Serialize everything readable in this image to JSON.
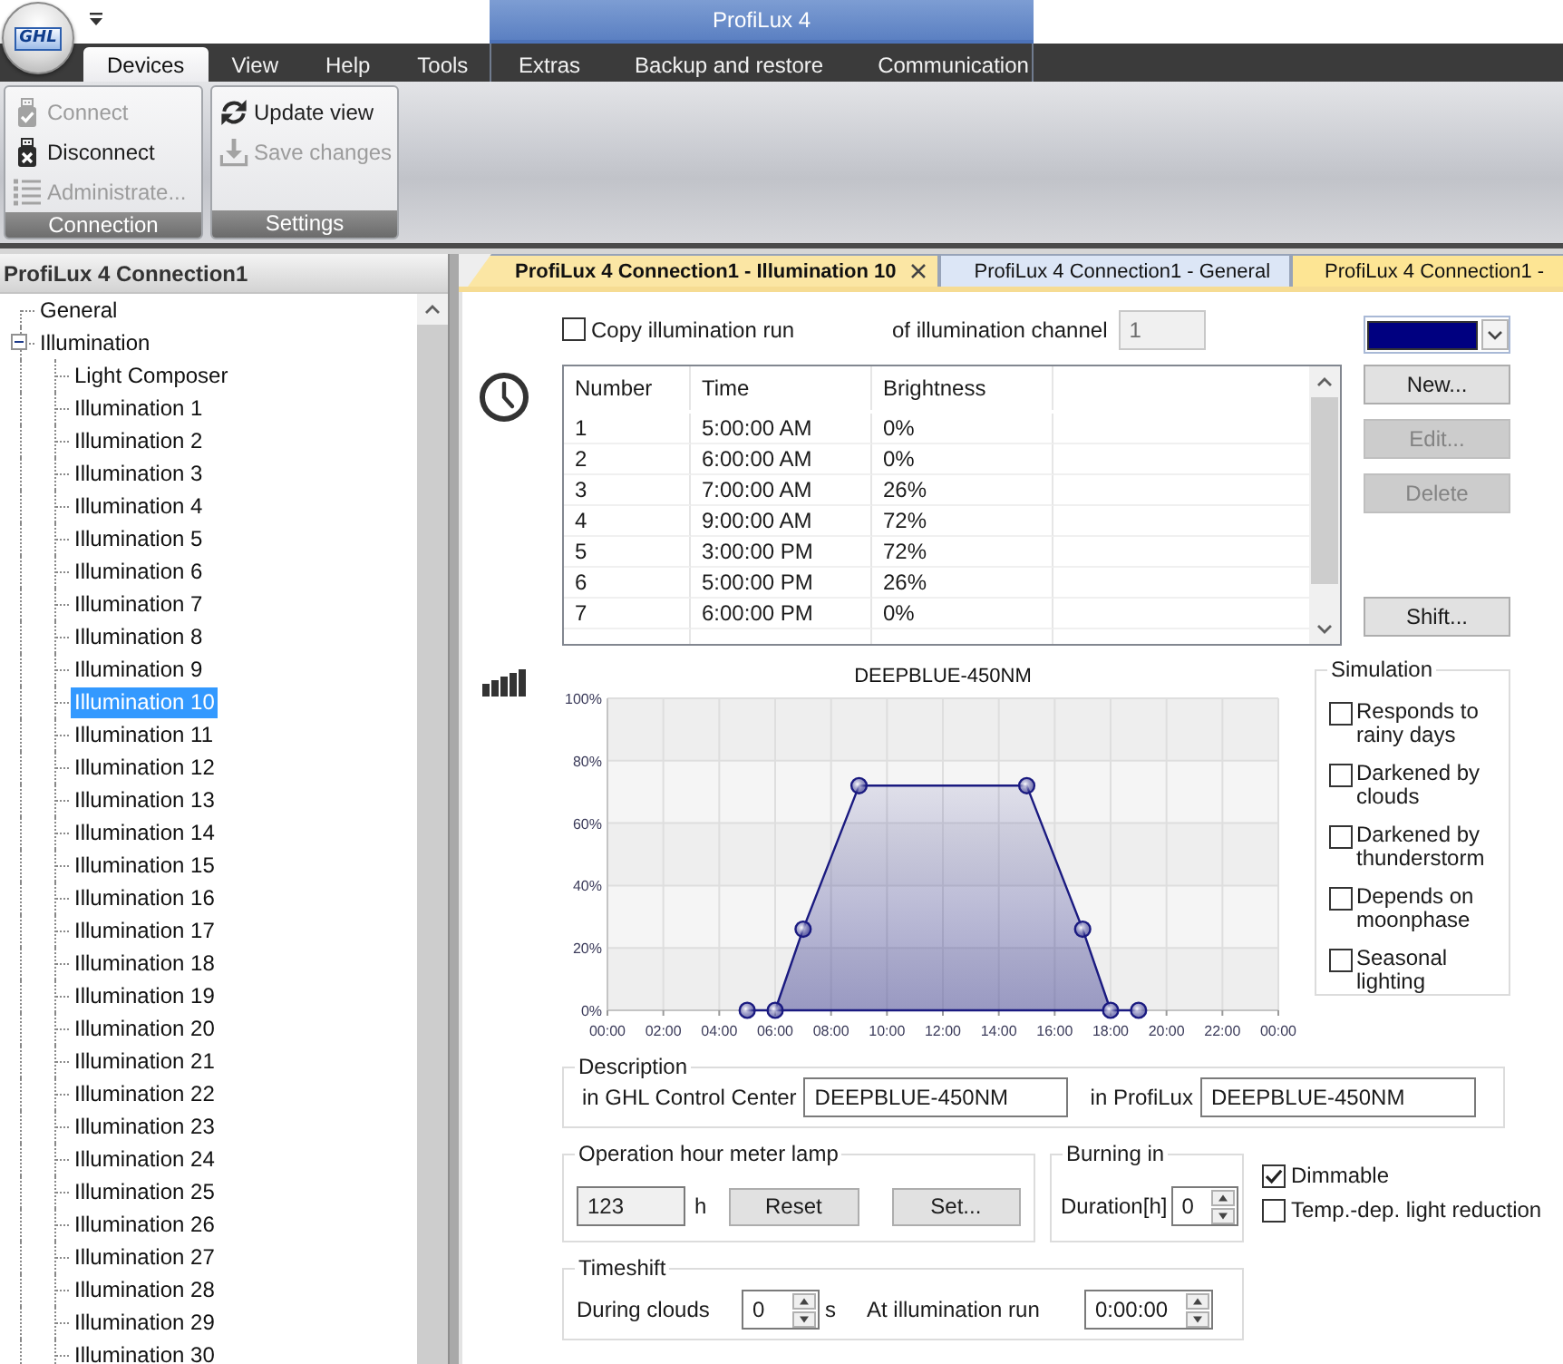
{
  "app": {
    "logo": "GHL"
  },
  "ribbon": {
    "tabs": [
      {
        "label": "Devices",
        "selected": true
      },
      {
        "label": "View",
        "selected": false
      },
      {
        "label": "Help",
        "selected": false
      },
      {
        "label": "Tools",
        "selected": false
      }
    ],
    "contextual_tabs": {
      "title": "ProfiLux 4",
      "tabs": [
        {
          "label": "Extras",
          "selected": false
        },
        {
          "label": "Backup and restore",
          "selected": false
        },
        {
          "label": "Communication",
          "selected": false
        }
      ]
    },
    "groups": [
      {
        "label": "Connection",
        "items": [
          {
            "label": "Connect",
            "disabled": true
          },
          {
            "label": "Disconnect",
            "disabled": false
          },
          {
            "label": "Administrate...",
            "disabled": true
          }
        ]
      },
      {
        "label": "Settings",
        "items": [
          {
            "label": "Update view",
            "disabled": false
          },
          {
            "label": "Save changes",
            "disabled": true
          }
        ]
      }
    ]
  },
  "tree": {
    "title": "ProfiLux 4 Connection1",
    "items": [
      {
        "label": "General",
        "selected": false
      },
      {
        "label": "Illumination",
        "selected": false,
        "expanded": true,
        "children": [
          {
            "label": "Light Composer",
            "selected": false
          },
          {
            "label": "Illumination 1",
            "selected": false
          },
          {
            "label": "Illumination 2",
            "selected": false
          },
          {
            "label": "Illumination 3",
            "selected": false
          },
          {
            "label": "Illumination 4",
            "selected": false
          },
          {
            "label": "Illumination 5",
            "selected": false
          },
          {
            "label": "Illumination 6",
            "selected": false
          },
          {
            "label": "Illumination 7",
            "selected": false
          },
          {
            "label": "Illumination 8",
            "selected": false
          },
          {
            "label": "Illumination 9",
            "selected": false
          },
          {
            "label": "Illumination 10",
            "selected": true
          },
          {
            "label": "Illumination 11",
            "selected": false
          },
          {
            "label": "Illumination 12",
            "selected": false
          },
          {
            "label": "Illumination 13",
            "selected": false
          },
          {
            "label": "Illumination 14",
            "selected": false
          },
          {
            "label": "Illumination 15",
            "selected": false
          },
          {
            "label": "Illumination 16",
            "selected": false
          },
          {
            "label": "Illumination 17",
            "selected": false
          },
          {
            "label": "Illumination 18",
            "selected": false
          },
          {
            "label": "Illumination 19",
            "selected": false
          },
          {
            "label": "Illumination 20",
            "selected": false
          },
          {
            "label": "Illumination 21",
            "selected": false
          },
          {
            "label": "Illumination 22",
            "selected": false
          },
          {
            "label": "Illumination 23",
            "selected": false
          },
          {
            "label": "Illumination 24",
            "selected": false
          },
          {
            "label": "Illumination 25",
            "selected": false
          },
          {
            "label": "Illumination 26",
            "selected": false
          },
          {
            "label": "Illumination 27",
            "selected": false
          },
          {
            "label": "Illumination 28",
            "selected": false
          },
          {
            "label": "Illumination 29",
            "selected": false
          },
          {
            "label": "Illumination 30",
            "selected": false
          }
        ]
      }
    ]
  },
  "document_tabs": [
    {
      "label": "ProfiLux 4 Connection1 - Illumination 10",
      "selected": true,
      "color": "#fbe6a4"
    },
    {
      "label": "ProfiLux 4 Connection1 - General",
      "selected": false,
      "color": "#dce6f6"
    },
    {
      "label": "ProfiLux 4 Connection1 -",
      "selected": false,
      "color": "#fde594"
    }
  ],
  "page": {
    "copy_run": {
      "label": "Copy illumination run",
      "checked": false
    },
    "source_channel": {
      "label": "of illumination channel",
      "value": "1",
      "disabled": true
    },
    "color_picker": {
      "color": "#000080"
    },
    "schedule": {
      "columns": [
        "Number",
        "Time",
        "Brightness"
      ],
      "rows": [
        [
          "1",
          "5:00:00 AM",
          "0%"
        ],
        [
          "2",
          "6:00:00 AM",
          "0%"
        ],
        [
          "3",
          "7:00:00 AM",
          "26%"
        ],
        [
          "4",
          "9:00:00 AM",
          "72%"
        ],
        [
          "5",
          "3:00:00 PM",
          "72%"
        ],
        [
          "6",
          "5:00:00 PM",
          "26%"
        ],
        [
          "7",
          "6:00:00 PM",
          "0%"
        ]
      ]
    },
    "actions": [
      {
        "label": "New...",
        "disabled": false
      },
      {
        "label": "Edit...",
        "disabled": true
      },
      {
        "label": "Delete",
        "disabled": true
      },
      {
        "label": "Shift...",
        "disabled": false
      }
    ],
    "chart_data": {
      "type": "area",
      "title": "DEEPBLUE-450NM",
      "grid": true,
      "x": [
        5,
        6,
        7,
        9,
        15,
        17,
        18,
        19
      ],
      "series": [
        {
          "color": "#1a1a80",
          "values": [
            0,
            0,
            26,
            72,
            72,
            26,
            0,
            0
          ]
        }
      ],
      "xlim": [
        0,
        24
      ],
      "ylim": [
        0,
        100
      ],
      "xticks": [
        {
          "value": 0,
          "label": "00:00"
        },
        {
          "value": 2,
          "label": "02:00"
        },
        {
          "value": 4,
          "label": "04:00"
        },
        {
          "value": 6,
          "label": "06:00"
        },
        {
          "value": 8,
          "label": "08:00"
        },
        {
          "value": 10,
          "label": "10:00"
        },
        {
          "value": 12,
          "label": "12:00"
        },
        {
          "value": 14,
          "label": "14:00"
        },
        {
          "value": 16,
          "label": "16:00"
        },
        {
          "value": 18,
          "label": "18:00"
        },
        {
          "value": 20,
          "label": "20:00"
        },
        {
          "value": 22,
          "label": "22:00"
        },
        {
          "value": 24,
          "label": "00:00"
        }
      ],
      "yticks": [
        {
          "value": 0,
          "label": "0%"
        },
        {
          "value": 20,
          "label": "20%"
        },
        {
          "value": 40,
          "label": "40%"
        },
        {
          "value": 60,
          "label": "60%"
        },
        {
          "value": 80,
          "label": "80%"
        },
        {
          "value": 100,
          "label": "100%"
        }
      ]
    },
    "simulation": {
      "title": "Simulation",
      "options": [
        {
          "label": "Responds to rainy days",
          "checked": false
        },
        {
          "label": "Darkened by clouds",
          "checked": false
        },
        {
          "label": "Darkened by thunderstorm",
          "checked": false
        },
        {
          "label": "Depends on moonphase",
          "checked": false
        },
        {
          "label": "Seasonal lighting",
          "checked": false
        }
      ]
    },
    "description": {
      "title": "Description",
      "fields": [
        {
          "label": "in GHL Control Center",
          "value": "DEEPBLUE-450NM"
        },
        {
          "label": "in ProfiLux",
          "value": "DEEPBLUE-450NM"
        }
      ]
    },
    "operation_hours": {
      "title": "Operation hour meter lamp",
      "value": "123",
      "disabled": true,
      "unit": "h",
      "buttons": [
        "Reset",
        "Set..."
      ]
    },
    "burning_in": {
      "title": "Burning in",
      "label": "Duration[h]",
      "value": "0"
    },
    "options": [
      {
        "label": "Dimmable",
        "checked": true
      },
      {
        "label": "Temp.-dep. light reduction",
        "checked": false
      }
    ],
    "timeshift": {
      "title": "Timeshift",
      "fields": [
        {
          "label": "During clouds",
          "value": "0",
          "unit": "s"
        },
        {
          "label": "At illumination run",
          "value": "0:00:00"
        }
      ]
    }
  }
}
